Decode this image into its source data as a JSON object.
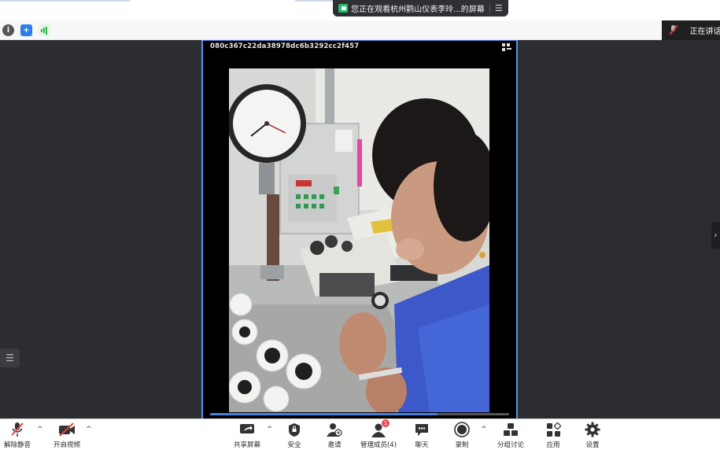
{
  "top": {
    "watching_banner": "您正在观看杭州鹳山仪表李玲...的屏幕",
    "speaking_label": "正在讲话"
  },
  "share": {
    "video_id": "080c367c22da38978dc6b3292cc2f457",
    "progress": 0.76
  },
  "toolbar": {
    "unmute": "解除静音",
    "start_video": "开启视频",
    "share_screen": "共享屏幕",
    "security": "安全",
    "invite": "邀请",
    "manage_members": "管理成员(4)",
    "members_badge": "1",
    "chat": "聊天",
    "record": "录制",
    "breakout": "分组讨论",
    "apps": "应用",
    "settings": "设置"
  },
  "colors": {
    "share_border": "#5d8ff2",
    "badge": "#ee4a4a",
    "recording_green": "#23c16b"
  }
}
